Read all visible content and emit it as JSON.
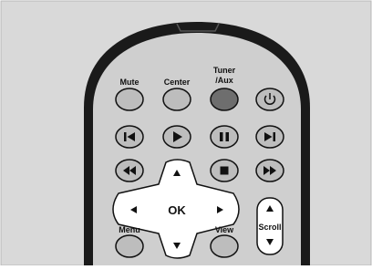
{
  "remote": {
    "labels": {
      "mute": "Mute",
      "center": "Center",
      "tuner_line1": "Tuner",
      "tuner_line2": "/Aux",
      "ok": "OK",
      "menu": "Menu",
      "view": "View",
      "scroll": "Scroll"
    },
    "colors": {
      "background": "#d9d9d9",
      "body": "#cfcfcf",
      "button": "#bdbdbd",
      "button_dark": "#6e6e6e",
      "stroke": "#111111"
    }
  }
}
